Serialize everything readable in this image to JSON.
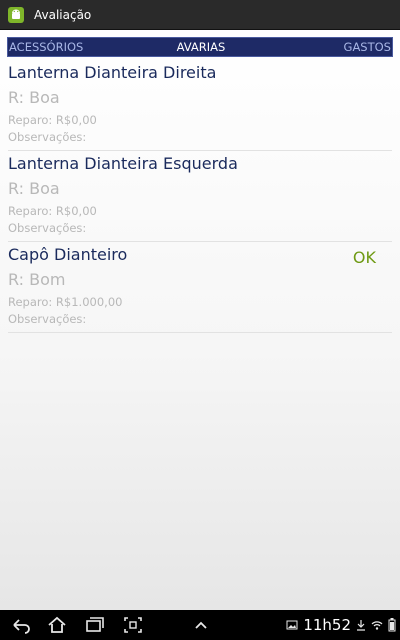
{
  "app": {
    "title": "Avaliação",
    "icon": "android-robot-icon",
    "accent_color": "#1e2a66"
  },
  "tabs": [
    {
      "label": "ACESSÓRIOS",
      "selected": false
    },
    {
      "label": "AVARIAS",
      "selected": true
    },
    {
      "label": "GASTOS",
      "selected": false
    }
  ],
  "items": [
    {
      "title": "Lanterna Dianteira Direita",
      "status": "R: Boa",
      "repair": "Reparo: R$0,00",
      "observations": "Observações:",
      "badge": ""
    },
    {
      "title": "Lanterna Dianteira Esquerda",
      "status": "R: Boa",
      "repair": "Reparo: R$0,00",
      "observations": "Observações:",
      "badge": ""
    },
    {
      "title": "Capô Dianteiro",
      "status": "R: Bom",
      "repair": "Reparo: R$1.000,00",
      "observations": "Observações:",
      "badge": "OK"
    }
  ],
  "system_bar": {
    "time": "11h52",
    "icons": [
      "back-icon",
      "home-icon",
      "recent-apps-icon",
      "screenshot-icon",
      "menu-up-icon",
      "gallery-icon",
      "download-icon",
      "wifi-icon",
      "battery-icon"
    ]
  }
}
